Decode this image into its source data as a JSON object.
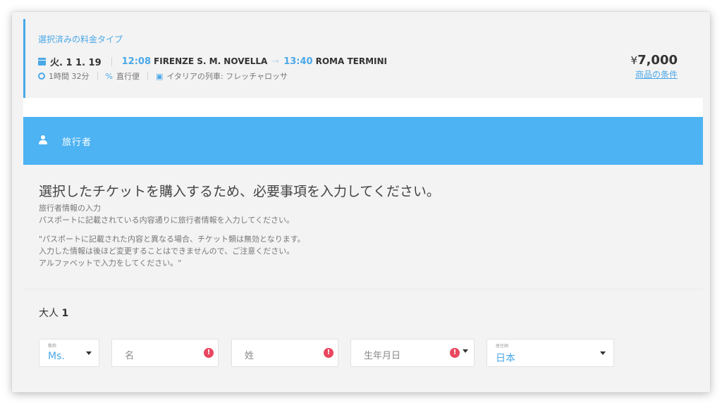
{
  "fare": {
    "title": "選択済みの料金タイプ",
    "date": "火. 1 1. 19",
    "depart_time": "12:08",
    "depart_station": "FIRENZE S. M. NOVELLA",
    "arrive_time": "13:40",
    "arrive_station": "ROMA TERMINI",
    "duration": "1時間 32分",
    "route_type": "直行便",
    "train": "イタリアの列車: フレッチャロッサ",
    "price_currency": "¥",
    "price_value": "7,000",
    "terms_link": "商品の条件"
  },
  "section": {
    "title": "旅行者"
  },
  "instructions": {
    "headline": "選択したチケットを購入するため、必要事項を入力してください。",
    "subtitle": "旅行者情報の入力",
    "passport_line": "パスポートに記載されている内容通りに旅行者情報を入力してください。",
    "note_line1": "\"パスポートに記載された内容と異なる場合、チケット類は無効となります。",
    "note_line2": "入力した情報は後ほど変更することはできませんので、ご注意ください。",
    "note_line3": "アルファベットで入力をしてください。\""
  },
  "passenger": {
    "label": "大人",
    "number": "1"
  },
  "form": {
    "title_label": "敬称",
    "title_value": "Ms.",
    "first_name_placeholder": "名",
    "last_name_placeholder": "姓",
    "birthdate_placeholder": "生年月日",
    "country_label": "居住国",
    "country_value": "日本",
    "error_mark": "!"
  },
  "colors": {
    "accent": "#4aa8e8",
    "header_bar": "#4db3f3",
    "error": "#e8475f"
  },
  "icons": {
    "date": "calendar-icon",
    "duration": "clock-icon",
    "route": "route-icon",
    "train": "train-icon",
    "traveler": "person-icon"
  }
}
